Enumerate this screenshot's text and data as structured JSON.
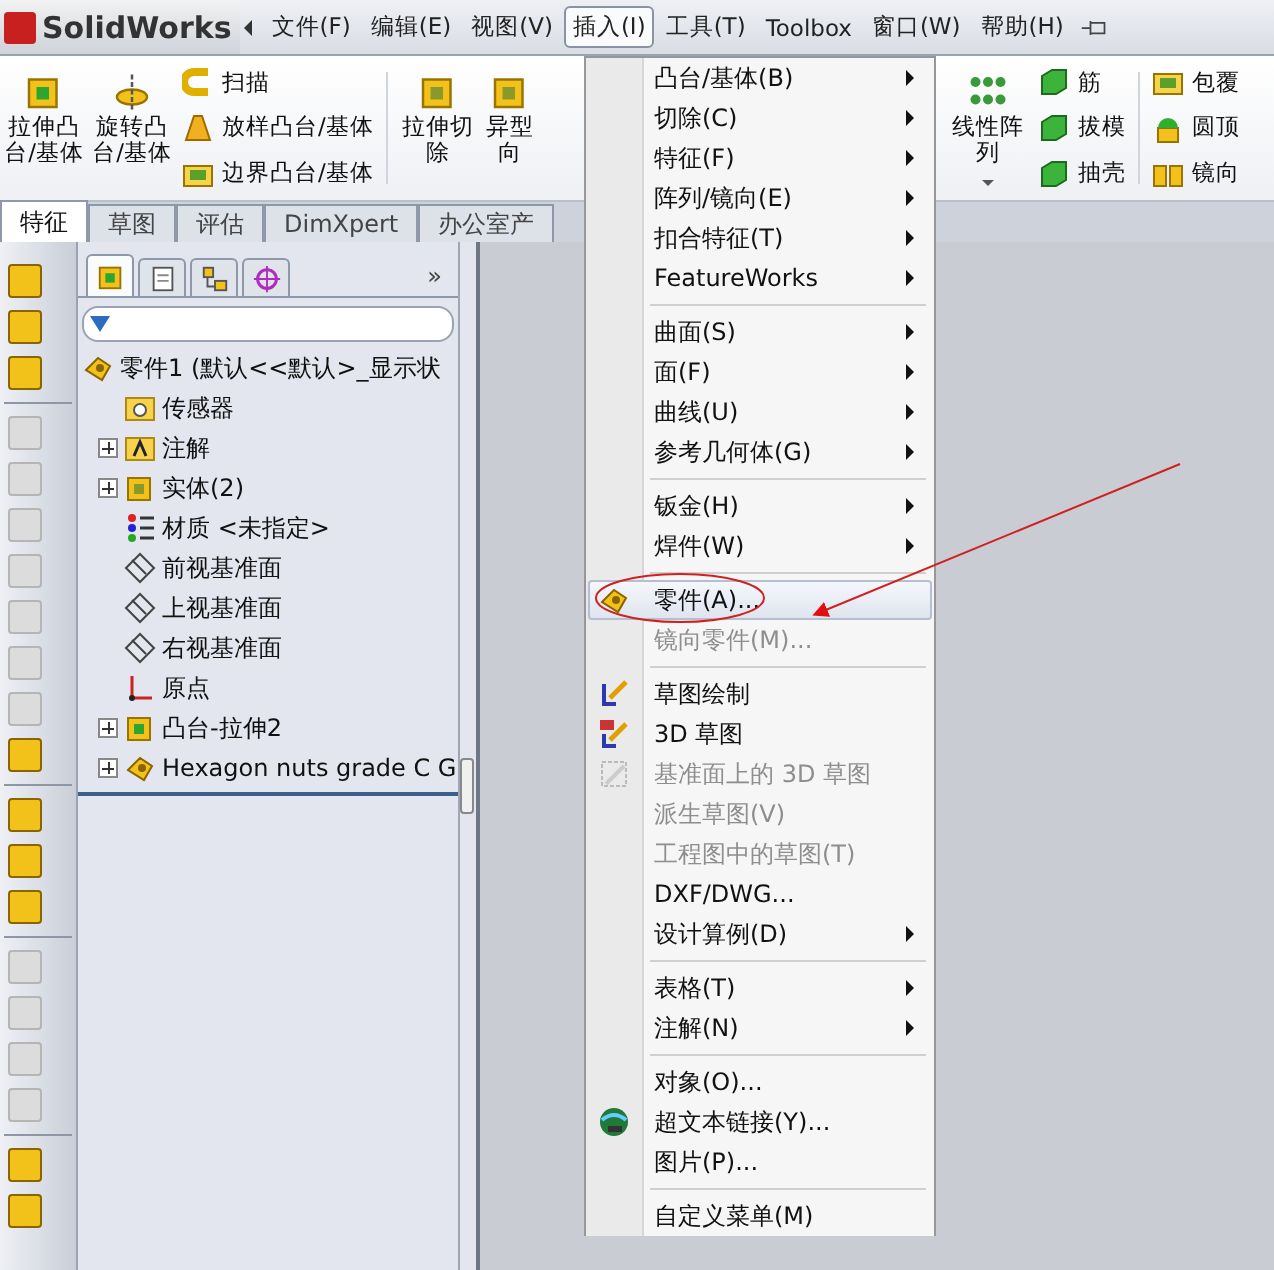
{
  "app": {
    "name": "SolidWorks"
  },
  "menubar": [
    {
      "label": "文件(F)",
      "selected": false
    },
    {
      "label": "编辑(E)",
      "selected": false
    },
    {
      "label": "视图(V)",
      "selected": false
    },
    {
      "label": "插入(I)",
      "selected": true
    },
    {
      "label": "工具(T)",
      "selected": false
    },
    {
      "label": "Toolbox",
      "selected": false
    },
    {
      "label": "窗口(W)",
      "selected": false
    },
    {
      "label": "帮助(H)",
      "selected": false
    }
  ],
  "ribbon": {
    "left": [
      {
        "kind": "large",
        "label": "拉伸凸台/基体"
      },
      {
        "kind": "large",
        "label": "旋转凸台/基体"
      },
      {
        "kind": "small",
        "items": [
          {
            "label": "扫描"
          },
          {
            "label": "放样凸台/基体"
          },
          {
            "label": "边界凸台/基体"
          }
        ]
      },
      {
        "kind": "large",
        "label": "拉伸切除"
      },
      {
        "kind": "large",
        "label": "异型向"
      }
    ],
    "right": [
      {
        "kind": "split",
        "label": "线性阵列"
      },
      {
        "kind": "small",
        "items": [
          {
            "label": "筋"
          },
          {
            "label": "拔模"
          },
          {
            "label": "抽壳"
          }
        ]
      },
      {
        "kind": "small",
        "items": [
          {
            "label": "包覆"
          },
          {
            "label": "圆顶"
          },
          {
            "label": "镜向"
          }
        ]
      }
    ]
  },
  "tabs": [
    {
      "label": "特征",
      "selected": true
    },
    {
      "label": "草图",
      "selected": false
    },
    {
      "label": "评估",
      "selected": false
    },
    {
      "label": "DimXpert",
      "selected": false
    },
    {
      "label": "办公室产",
      "selected": false
    }
  ],
  "left_toolbar": [
    {
      "kind": "tool",
      "disabled": false
    },
    {
      "kind": "tool",
      "disabled": false
    },
    {
      "kind": "tool",
      "disabled": false
    },
    {
      "kind": "separator"
    },
    {
      "kind": "tool",
      "disabled": true
    },
    {
      "kind": "tool",
      "disabled": true
    },
    {
      "kind": "tool",
      "disabled": true
    },
    {
      "kind": "tool",
      "disabled": true
    },
    {
      "kind": "tool",
      "disabled": true
    },
    {
      "kind": "tool",
      "disabled": true
    },
    {
      "kind": "tool",
      "disabled": true
    },
    {
      "kind": "tool",
      "disabled": false
    },
    {
      "kind": "separator"
    },
    {
      "kind": "tool",
      "disabled": false
    },
    {
      "kind": "tool",
      "disabled": false
    },
    {
      "kind": "tool",
      "disabled": false
    },
    {
      "kind": "separator"
    },
    {
      "kind": "tool",
      "disabled": true
    },
    {
      "kind": "tool",
      "disabled": true
    },
    {
      "kind": "tool",
      "disabled": true
    },
    {
      "kind": "tool",
      "disabled": true
    },
    {
      "kind": "separator"
    },
    {
      "kind": "tool",
      "disabled": false
    },
    {
      "kind": "tool",
      "disabled": false
    }
  ],
  "tree_panel": {
    "tabs": [
      {
        "selected": true
      },
      {
        "selected": false
      },
      {
        "selected": false
      },
      {
        "selected": false
      }
    ],
    "more": "»",
    "tree": [
      {
        "kind": "part",
        "label": "零件1  (默认<<默认>_显示状",
        "collapsed": false,
        "children": [
          {
            "kind": "sensor",
            "label": "传感器",
            "collapsed": false
          },
          {
            "kind": "annotation",
            "label": "注解",
            "collapsed": true
          },
          {
            "kind": "solid",
            "label": "实体(2)",
            "collapsed": true
          },
          {
            "kind": "material",
            "label": "材质 <未指定>",
            "collapsed": false
          },
          {
            "kind": "plane",
            "label": "前视基准面",
            "collapsed": false
          },
          {
            "kind": "plane",
            "label": "上视基准面",
            "collapsed": false
          },
          {
            "kind": "plane",
            "label": "右视基准面",
            "collapsed": false
          },
          {
            "kind": "origin",
            "label": "原点",
            "collapsed": false
          },
          {
            "kind": "feature",
            "label": "凸台-拉伸2",
            "collapsed": true
          },
          {
            "kind": "part",
            "label": "Hexagon nuts grade C G",
            "collapsed": true
          }
        ]
      }
    ]
  },
  "insert_menu": [
    {
      "kind": "item",
      "label": "凸台/基体(B)",
      "submenu": true,
      "disabled": false,
      "selected": false
    },
    {
      "kind": "item",
      "label": "切除(C)",
      "submenu": true,
      "disabled": false,
      "selected": false
    },
    {
      "kind": "item",
      "label": "特征(F)",
      "submenu": true,
      "disabled": false,
      "selected": false
    },
    {
      "kind": "item",
      "label": "阵列/镜向(E)",
      "submenu": true,
      "disabled": false,
      "selected": false
    },
    {
      "kind": "item",
      "label": "扣合特征(T)",
      "submenu": true,
      "disabled": false,
      "selected": false
    },
    {
      "kind": "item",
      "label": "FeatureWorks",
      "submenu": true,
      "disabled": false,
      "selected": false
    },
    {
      "kind": "separator"
    },
    {
      "kind": "item",
      "label": "曲面(S)",
      "submenu": true,
      "disabled": false,
      "selected": false
    },
    {
      "kind": "item",
      "label": "面(F)",
      "submenu": true,
      "disabled": false,
      "selected": false
    },
    {
      "kind": "item",
      "label": "曲线(U)",
      "submenu": true,
      "disabled": false,
      "selected": false
    },
    {
      "kind": "item",
      "label": "参考几何体(G)",
      "submenu": true,
      "disabled": false,
      "selected": false
    },
    {
      "kind": "separator"
    },
    {
      "kind": "item",
      "label": "钣金(H)",
      "submenu": true,
      "disabled": false,
      "selected": false
    },
    {
      "kind": "item",
      "label": "焊件(W)",
      "submenu": true,
      "disabled": false,
      "selected": false
    },
    {
      "kind": "separator"
    },
    {
      "kind": "item",
      "label": "零件(A)...",
      "submenu": false,
      "disabled": false,
      "selected": true
    },
    {
      "kind": "item",
      "label": "镜向零件(M)...",
      "submenu": false,
      "disabled": true,
      "selected": false
    },
    {
      "kind": "separator"
    },
    {
      "kind": "item",
      "label": "草图绘制",
      "submenu": false,
      "disabled": false,
      "selected": false
    },
    {
      "kind": "item",
      "label": "3D 草图",
      "submenu": false,
      "disabled": false,
      "selected": false
    },
    {
      "kind": "item",
      "label": "基准面上的 3D 草图",
      "submenu": false,
      "disabled": true,
      "selected": false
    },
    {
      "kind": "item",
      "label": "派生草图(V)",
      "submenu": false,
      "disabled": true,
      "selected": false
    },
    {
      "kind": "item",
      "label": "工程图中的草图(T)",
      "submenu": false,
      "disabled": true,
      "selected": false
    },
    {
      "kind": "item",
      "label": "DXF/DWG...",
      "submenu": false,
      "disabled": false,
      "selected": false
    },
    {
      "kind": "item",
      "label": "设计算例(D)",
      "submenu": true,
      "disabled": false,
      "selected": false
    },
    {
      "kind": "separator"
    },
    {
      "kind": "item",
      "label": "表格(T)",
      "submenu": true,
      "disabled": false,
      "selected": false
    },
    {
      "kind": "item",
      "label": "注解(N)",
      "submenu": true,
      "disabled": false,
      "selected": false
    },
    {
      "kind": "separator"
    },
    {
      "kind": "item",
      "label": "对象(O)...",
      "submenu": false,
      "disabled": false,
      "selected": false
    },
    {
      "kind": "item",
      "label": "超文本链接(Y)...",
      "submenu": false,
      "disabled": false,
      "selected": false
    },
    {
      "kind": "item",
      "label": "图片(P)...",
      "submenu": false,
      "disabled": false,
      "selected": false
    },
    {
      "kind": "separator"
    },
    {
      "kind": "item",
      "label": "自定义菜单(M)",
      "submenu": false,
      "disabled": false,
      "selected": false
    }
  ]
}
